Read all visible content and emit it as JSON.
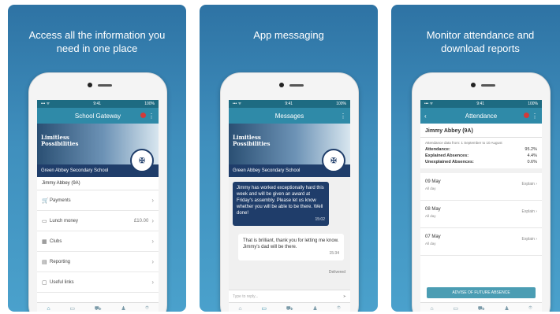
{
  "panels": [
    {
      "caption": "Access all the information you\nneed in one place",
      "status": {
        "time": "9:41",
        "battery": "100%"
      },
      "title": "School Gateway",
      "banner_text": "Limitless\nPossibilities",
      "school": "Green Abbey Secondary School",
      "student": "Jimmy Abbey (9A)",
      "menu": [
        {
          "icon": "cart-icon",
          "glyph": "🛒",
          "label": "Payments",
          "extra": ""
        },
        {
          "icon": "cash-icon",
          "glyph": "💵",
          "label": "Lunch money",
          "extra": "£10.00"
        },
        {
          "icon": "calendar-icon",
          "glyph": "▦",
          "label": "Clubs",
          "extra": ""
        },
        {
          "icon": "report-icon",
          "glyph": "▤",
          "label": "Reporting",
          "extra": ""
        },
        {
          "icon": "link-icon",
          "glyph": "▢",
          "label": "Useful links",
          "extra": ""
        }
      ]
    },
    {
      "caption": "App messaging",
      "status": {
        "time": "9:41",
        "battery": "100%"
      },
      "title": "Messages",
      "banner_text": "Limitless\nPossibilities",
      "school": "Green Abbey Secondary School",
      "messages": [
        {
          "text": "Jimmy has worked exceptionally hard this week and will be given an award at Friday's assembly. Please let us know whether you will be able to be there. Well done!",
          "time": "15:02"
        },
        {
          "text": "That is brilliant, thank you for letting me know. Jimmy's dad will be there.",
          "time": "15:34"
        }
      ],
      "delivered": "Delivered",
      "reply_placeholder": "Type to reply..."
    },
    {
      "caption": "Monitor attendance and\ndownload reports",
      "status": {
        "time": "9:41",
        "battery": "100%"
      },
      "title": "Attendance",
      "student": "Jimmy Abbey (9A)",
      "data_from": "Attendance data from: 1 September to 10 August",
      "stats": [
        {
          "label": "Attendance:",
          "value": "95.2%"
        },
        {
          "label": "Explained Absences:",
          "value": "4.4%"
        },
        {
          "label": "Unexplained Absences:",
          "value": "0.6%"
        }
      ],
      "absences": [
        {
          "date": "09 May",
          "span": "All day",
          "action": "Explain"
        },
        {
          "date": "08 May",
          "span": "All day",
          "action": "Explain"
        },
        {
          "date": "07 May",
          "span": "All day",
          "action": "Explain"
        }
      ],
      "advise_button": "ADVISE OF FUTURE ABSENCE"
    }
  ]
}
